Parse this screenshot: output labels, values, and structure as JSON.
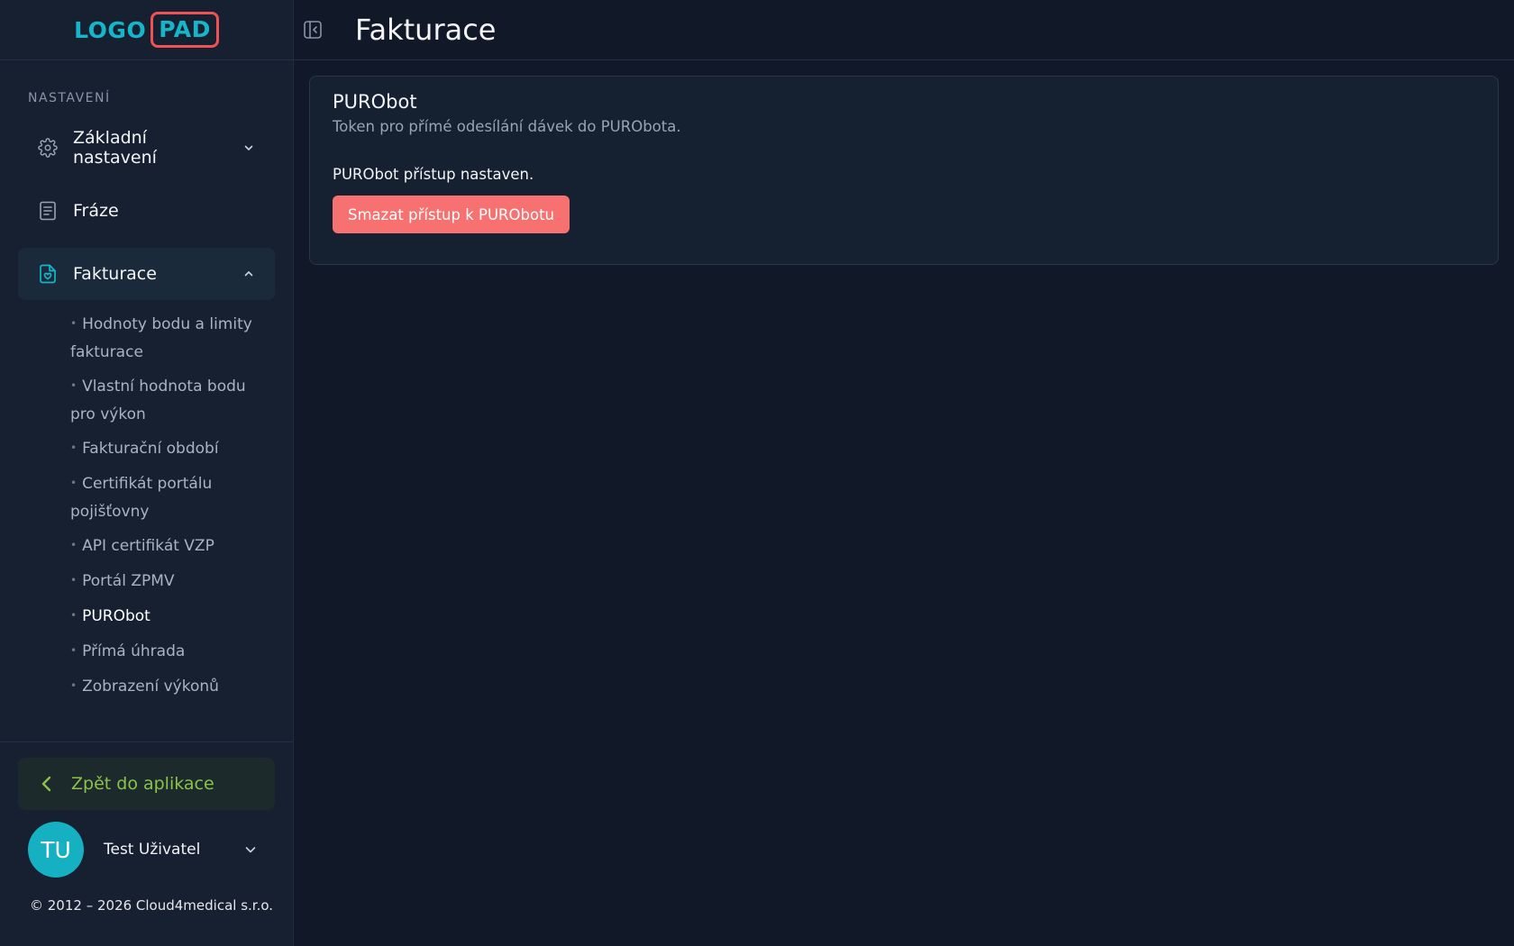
{
  "logo": {
    "part1": "LOGO",
    "part2": "PAD"
  },
  "colors": {
    "accent": "#16b5c9",
    "logo_border": "#f05252",
    "danger": "#f87171",
    "back_text": "#8bc34a"
  },
  "sidebar": {
    "section_label": "NASTAVENÍ",
    "items": [
      {
        "label": "Základní nastavení",
        "icon": "gear-icon",
        "chevron": "chevron-down-icon"
      },
      {
        "label": "Fráze",
        "icon": "document-icon"
      },
      {
        "label": "Fakturace",
        "icon": "invoice-icon",
        "chevron": "chevron-up-icon",
        "active": true
      }
    ],
    "subitems": [
      {
        "label": "Hodnoty bodu a limity fakturace"
      },
      {
        "label": "Vlastní hodnota bodu pro výkon"
      },
      {
        "label": "Fakturační období"
      },
      {
        "label": "Certifikát portálu pojišťovny"
      },
      {
        "label": "API certifikát VZP"
      },
      {
        "label": "Portál ZPMV"
      },
      {
        "label": "PURObot",
        "current": true
      },
      {
        "label": "Přímá úhrada"
      },
      {
        "label": "Zobrazení výkonů"
      }
    ],
    "back_label": "Zpět do aplikace",
    "user": {
      "initials": "TU",
      "name": "Test Uživatel"
    },
    "copyright": "© 2012 – 2026 Cloud4medical s.r.o."
  },
  "header": {
    "title": "Fakturace"
  },
  "card": {
    "title": "PURObot",
    "description": "Token pro přímé odesílání dávek do PURObota.",
    "status": "PURObot přístup nastaven.",
    "button_label": "Smazat přístup k PURObotu"
  }
}
